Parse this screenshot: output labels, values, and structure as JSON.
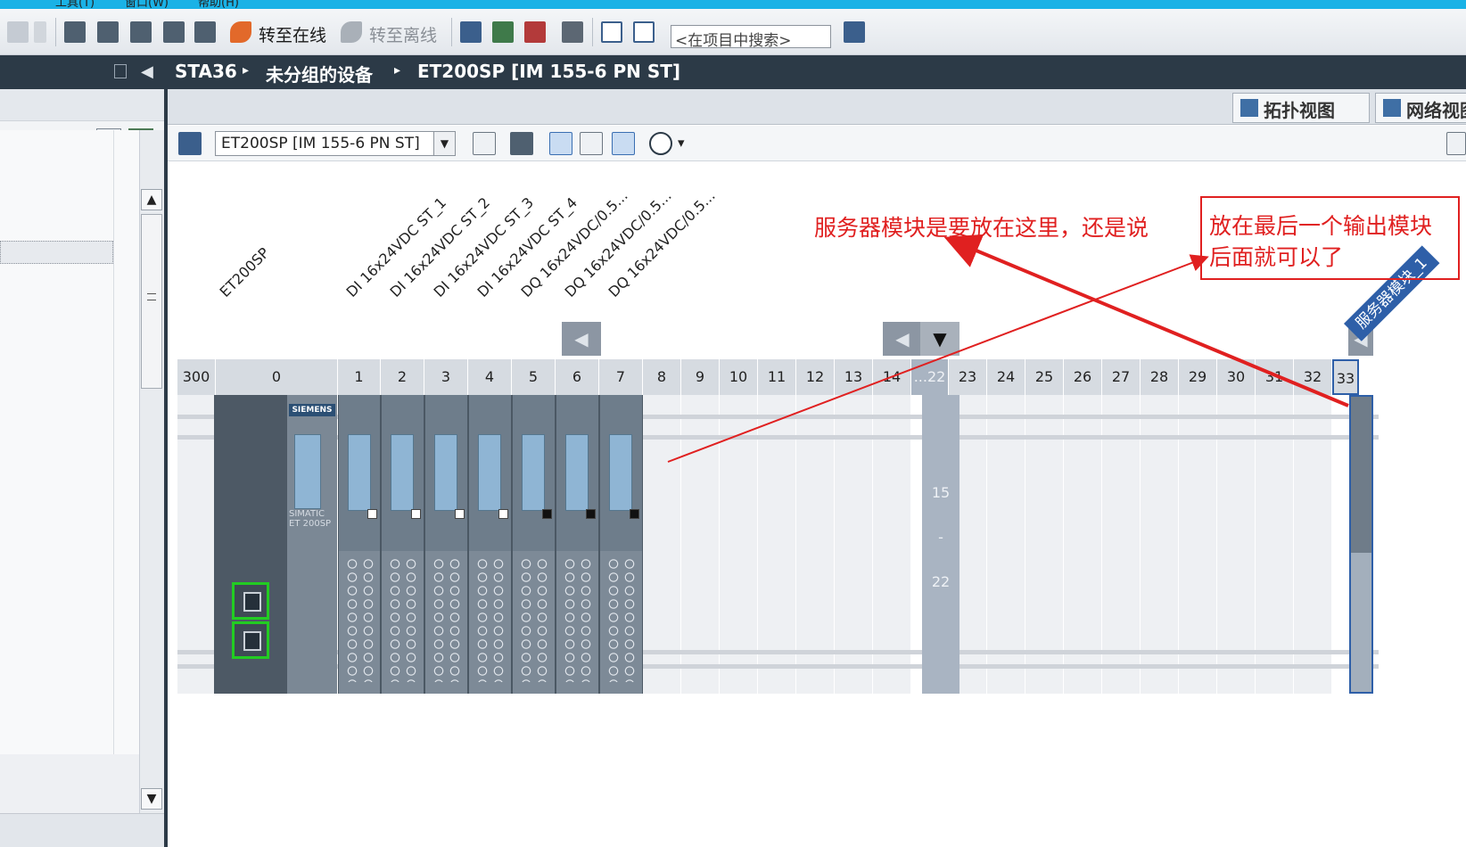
{
  "menubar": {
    "items": [
      "工具(T)",
      "窗口(W)",
      "帮助(H)"
    ]
  },
  "toolbar": {
    "go_online": "转至在线",
    "go_offline": "转至离线",
    "search_placeholder": "<在项目中搜索>"
  },
  "breadcrumb": {
    "items": [
      "STA36",
      "未分组的设备",
      "ET200SP [IM 155-6 PN ST]"
    ],
    "separator": "▸"
  },
  "view_tabs": {
    "topology": "拓扑视图",
    "network": "网络视图"
  },
  "device_toolbar": {
    "selected_device": "ET200SP [IM 155-6 PN ST]"
  },
  "module_labels": [
    "ET200SP",
    "DI 16x24VDC ST_1",
    "DI 16x24VDC ST_2",
    "DI 16x24VDC ST_3",
    "DI 16x24VDC ST_4",
    "DQ 16x24VDC/0.5...",
    "DQ 16x24VDC/0.5...",
    "DQ 16x24VDC/0.5..."
  ],
  "slots": [
    "300",
    "0",
    "1",
    "2",
    "3",
    "4",
    "5",
    "6",
    "7",
    "8",
    "9",
    "10",
    "11",
    "12",
    "13",
    "14",
    "...22",
    "23",
    "24",
    "25",
    "26",
    "27",
    "28",
    "29",
    "30",
    "31",
    "32",
    "33"
  ],
  "range_column": {
    "start": "15",
    "dash": "-",
    "end": "22"
  },
  "head_module": {
    "brand": "SIEMENS",
    "model": "SIMATIC ET 200SP"
  },
  "server_module_tag": "服务器模块_1",
  "annotations": {
    "question": "服务器模块是要放在这里，还是说",
    "option": "放在最后一个输出模块后面就可以了"
  },
  "colors": {
    "annotation": "#e02020",
    "selection": "#2e5fa8",
    "header_bar": "#2c3a47",
    "port_highlight": "#22cc22"
  }
}
